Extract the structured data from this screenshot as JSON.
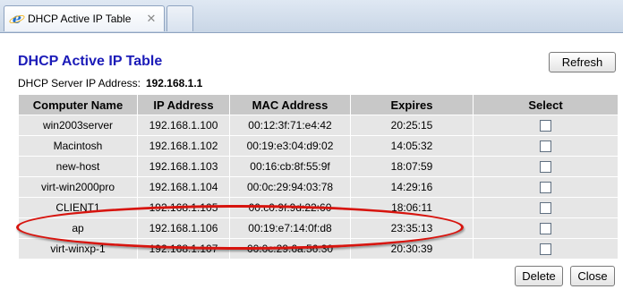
{
  "browser": {
    "tab_title": "DHCP Active IP Table",
    "tab_close_glyph": "✕",
    "tab_icon": "ie-browser-icon"
  },
  "page": {
    "heading": "DHCP Active IP Table",
    "server_label": "DHCP Server IP Address:",
    "server_ip": "192.168.1.1"
  },
  "buttons": {
    "refresh": "Refresh",
    "delete": "Delete",
    "close": "Close"
  },
  "table": {
    "headers": [
      "Computer Name",
      "IP Address",
      "MAC Address",
      "Expires",
      "Select"
    ],
    "rows": [
      {
        "name": "win2003server",
        "ip": "192.168.1.100",
        "mac": "00:12:3f:71:e4:42",
        "expires": "20:25:15",
        "selected": false
      },
      {
        "name": "Macintosh",
        "ip": "192.168.1.102",
        "mac": "00:19:e3:04:d9:02",
        "expires": "14:05:32",
        "selected": false
      },
      {
        "name": "new-host",
        "ip": "192.168.1.103",
        "mac": "00:16:cb:8f:55:9f",
        "expires": "18:07:59",
        "selected": false
      },
      {
        "name": "virt-win2000pro",
        "ip": "192.168.1.104",
        "mac": "00:0c:29:94:03:78",
        "expires": "14:29:16",
        "selected": false
      },
      {
        "name": "CLIENT1",
        "ip": "192.168.1.105",
        "mac": "00:c0:9f:9d:22:60",
        "expires": "18:06:11",
        "selected": false
      },
      {
        "name": "ap",
        "ip": "192.168.1.106",
        "mac": "00:19:e7:14:0f:d8",
        "expires": "23:35:13",
        "selected": false
      },
      {
        "name": "virt-winxp-1",
        "ip": "192.168.1.107",
        "mac": "00:0c:29:6a:56:30",
        "expires": "20:30:39",
        "selected": false
      }
    ]
  },
  "annotation": {
    "highlighted_row_name": "ap",
    "color": "#d7140e"
  },
  "colors": {
    "heading": "#1b1bb8",
    "header_bg": "#c8c8c8",
    "row_bg": "#e6e6e6"
  }
}
